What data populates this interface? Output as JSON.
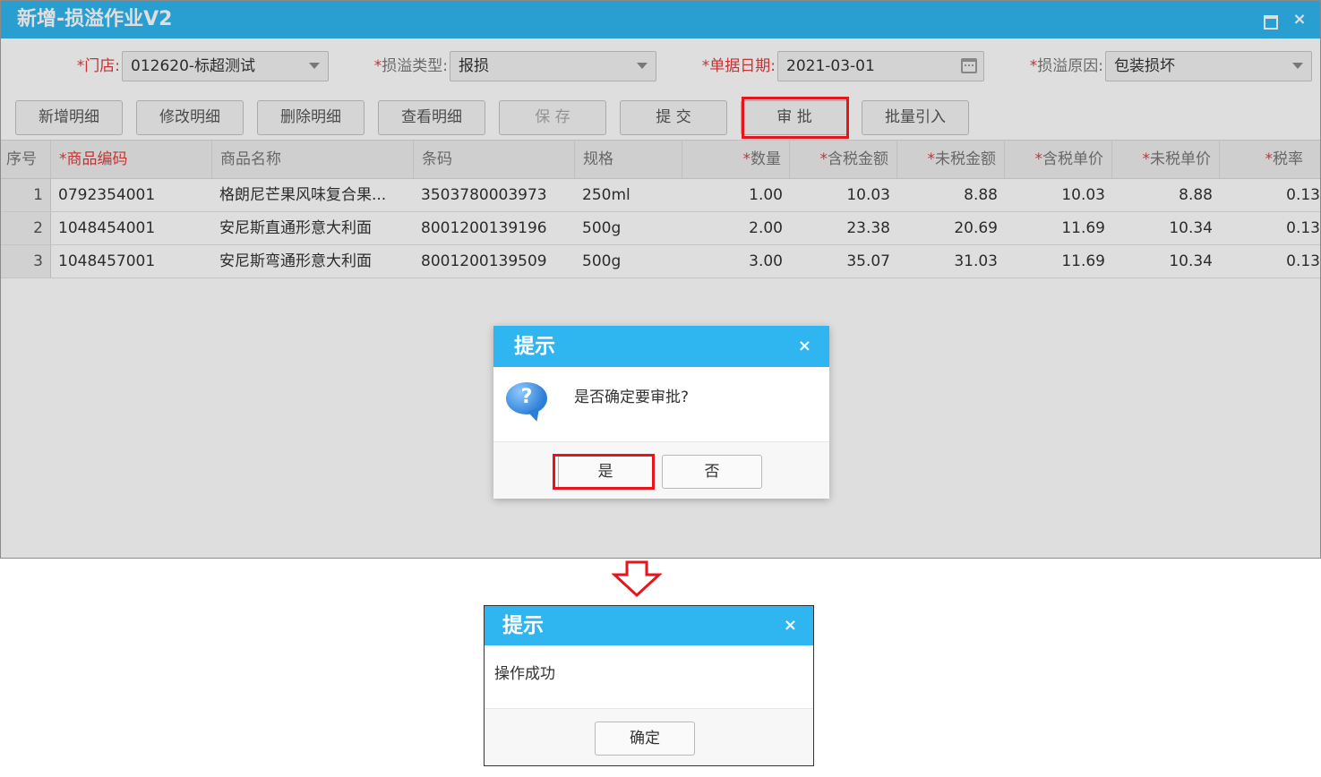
{
  "window": {
    "title": "新增-损溢作业V2",
    "close_glyph": "×"
  },
  "form": {
    "store": {
      "label": "门店:",
      "value": "012620-标超测试"
    },
    "type": {
      "label": "损溢类型:",
      "value": "报损"
    },
    "date": {
      "label": "单据日期:",
      "value": "2021-03-01"
    },
    "reason": {
      "label": "损溢原因:",
      "value": "包装损坏"
    },
    "required_mark": "*"
  },
  "toolbar": {
    "add_detail": "新增明细",
    "edit_detail": "修改明细",
    "delete_detail": "删除明细",
    "view_detail": "查看明细",
    "save": "保 存",
    "submit": "提 交",
    "approve": "审 批",
    "batch_import": "批量引入"
  },
  "grid": {
    "headers": {
      "index": "序号",
      "code": "商品编码",
      "name": "商品名称",
      "barcode": "条码",
      "spec": "规格",
      "qty": "数量",
      "tax_amount": "含税金额",
      "notax_amount": "未税金额",
      "tax_price": "含税单价",
      "notax_price": "未税单价",
      "tax_rate": "税率"
    },
    "rows": [
      {
        "index": "1",
        "code": "0792354001",
        "name": "格朗尼芒果风味复合果...",
        "barcode": "3503780003973",
        "spec": "250ml",
        "qty": "1.00",
        "tax_amount": "10.03",
        "notax_amount": "8.88",
        "tax_price": "10.03",
        "notax_price": "8.88",
        "tax_rate": "0.13"
      },
      {
        "index": "2",
        "code": "1048454001",
        "name": "安尼斯直通形意大利面",
        "barcode": "8001200139196",
        "spec": "500g",
        "qty": "2.00",
        "tax_amount": "23.38",
        "notax_amount": "20.69",
        "tax_price": "11.69",
        "notax_price": "10.34",
        "tax_rate": "0.13"
      },
      {
        "index": "3",
        "code": "1048457001",
        "name": "安尼斯弯通形意大利面",
        "barcode": "8001200139509",
        "spec": "500g",
        "qty": "3.00",
        "tax_amount": "35.07",
        "notax_amount": "31.03",
        "tax_price": "11.69",
        "notax_price": "10.34",
        "tax_rate": "0.13"
      }
    ]
  },
  "confirm_dialog": {
    "title": "提示",
    "message": "是否确定要审批?",
    "yes": "是",
    "no": "否",
    "close_glyph": "×",
    "icon_glyph": "?"
  },
  "result_dialog": {
    "title": "提示",
    "message": "操作成功",
    "ok": "确定",
    "close_glyph": "×"
  },
  "colors": {
    "title_bar": "#2fb6f1",
    "highlight": "#e8141b",
    "required": "#e03c3c"
  }
}
